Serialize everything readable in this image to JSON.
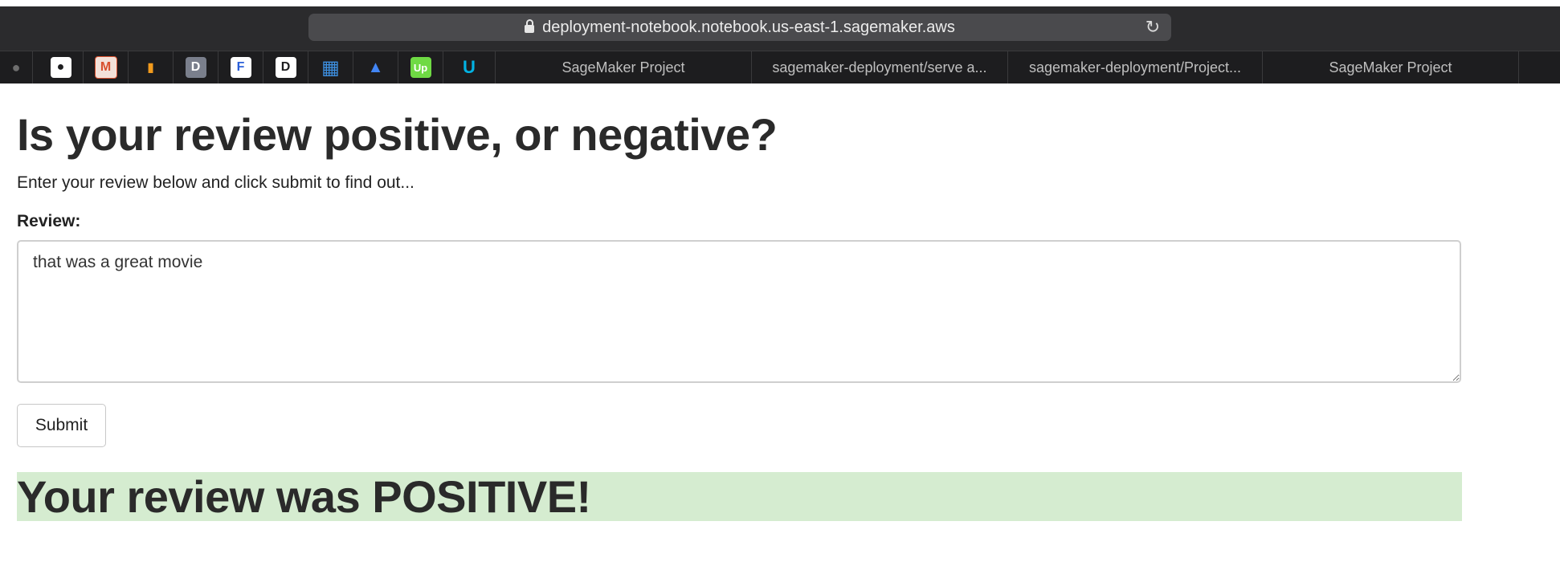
{
  "browser": {
    "url": "deployment-notebook.notebook.us-east-1.sagemaker.aws",
    "favorites": [
      {
        "name": "apple-icon",
        "glyph": "",
        "color": "#6e6e6e"
      },
      {
        "name": "apple-app-icon",
        "glyph": "",
        "color": "#ffffff"
      },
      {
        "name": "m-icon",
        "glyph": "M",
        "color": "#d8502e"
      },
      {
        "name": "analytics-icon",
        "glyph": "▮",
        "color": "#f29b1d"
      },
      {
        "name": "d-icon",
        "glyph": "D",
        "color": "#7a7f8c"
      },
      {
        "name": "f-icon",
        "glyph": "F",
        "color": "#2b5fd8"
      },
      {
        "name": "d3-icon",
        "glyph": "D",
        "color": "#ffffff"
      },
      {
        "name": "blocks-icon",
        "glyph": "▦",
        "color": "#3d8fe0"
      },
      {
        "name": "google-ads-icon",
        "glyph": "▲",
        "color": "#4285f4"
      },
      {
        "name": "upwork-icon",
        "glyph": "Up",
        "color": "#6fda44"
      },
      {
        "name": "udacity-icon",
        "glyph": "U",
        "color": "#02b3e4"
      }
    ],
    "tabs": [
      "SageMaker Project",
      "sagemaker-deployment/serve a...",
      "sagemaker-deployment/Project...",
      "SageMaker Project"
    ]
  },
  "page": {
    "title": "Is your review positive, or negative?",
    "subtitle": "Enter your review below and click submit to find out...",
    "review_label": "Review:",
    "review_value": "that was a great movie",
    "submit_label": "Submit",
    "result_text": "Your review was POSITIVE!",
    "result_color": "#d5ecd0"
  }
}
